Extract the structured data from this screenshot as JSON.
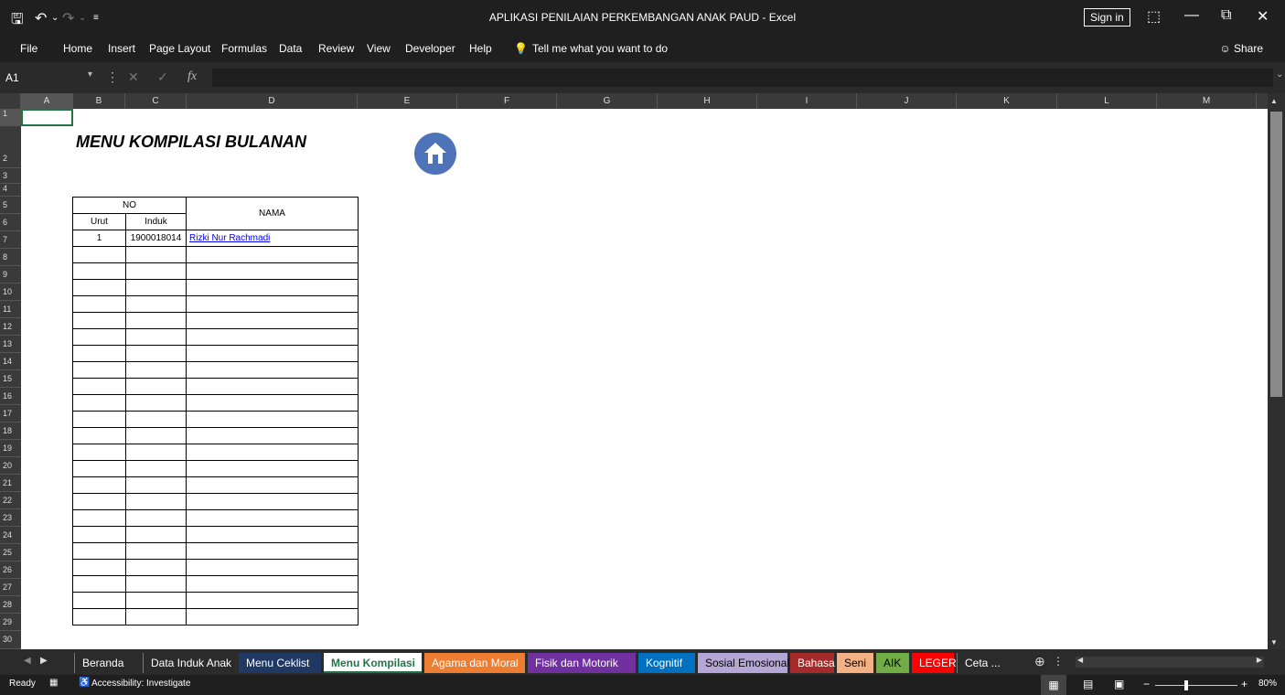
{
  "window": {
    "title": "APLIKASI PENILAIAN PERKEMBANGAN ANAK PAUD  -  Excel",
    "sign_in": "Sign in",
    "share": "Share"
  },
  "menu": [
    "File",
    "Home",
    "Insert",
    "Page Layout",
    "Formulas",
    "Data",
    "Review",
    "View",
    "Developer",
    "Help"
  ],
  "tell_me": "Tell me what you want to do",
  "formula_bar": {
    "name_box": "A1",
    "formula": ""
  },
  "columns": [
    "A",
    "B",
    "C",
    "D",
    "E",
    "F",
    "G",
    "H",
    "I",
    "J",
    "K",
    "L",
    "M"
  ],
  "rows": [
    "1",
    "2",
    "3",
    "4",
    "5",
    "6",
    "7",
    "8",
    "9",
    "10",
    "11",
    "12",
    "13",
    "14",
    "15",
    "16",
    "17",
    "18",
    "19",
    "20",
    "21",
    "22",
    "23",
    "24",
    "25",
    "26",
    "27",
    "28",
    "29",
    "30"
  ],
  "sheet": {
    "heading": "MENU KOMPILASI BULANAN",
    "table": {
      "header_no": "NO",
      "header_urut": "Urut",
      "header_induk": "Induk",
      "header_nama": "NAMA",
      "entries": [
        {
          "urut": "1",
          "induk": "1900018014",
          "nama": "Rizki Nur Rachmadi"
        }
      ]
    }
  },
  "tabs": [
    {
      "label": "Beranda",
      "bg": "#2b2b2b",
      "fg": "#ffffff"
    },
    {
      "label": "Data Induk Anak",
      "bg": "#2b2b2b",
      "fg": "#ffffff"
    },
    {
      "label": "Menu Ceklist",
      "bg": "#1f3864",
      "fg": "#ffffff"
    },
    {
      "label": "Menu Kompilasi",
      "bg": "#ffffff",
      "fg": "#217346",
      "active": true
    },
    {
      "label": "Agama dan Moral",
      "bg": "#ed7d31",
      "fg": "#ffffff"
    },
    {
      "label": "Fisik dan Motorik",
      "bg": "#7030a0",
      "fg": "#ffffff"
    },
    {
      "label": "Kognitif",
      "bg": "#0070c0",
      "fg": "#ffffff"
    },
    {
      "label": "Sosial Emosional",
      "bg": "#b4a7d6",
      "fg": "#000000"
    },
    {
      "label": "Bahasa",
      "bg": "#a52a2a",
      "fg": "#ffffff"
    },
    {
      "label": "Seni",
      "bg": "#f4b183",
      "fg": "#000000"
    },
    {
      "label": "AIK",
      "bg": "#70ad47",
      "fg": "#000000"
    },
    {
      "label": "LEGER",
      "bg": "#ff0000",
      "fg": "#ffffff"
    },
    {
      "label": "Ceta ...",
      "bg": "#2b2b2b",
      "fg": "#ffffff"
    }
  ],
  "status": {
    "ready": "Ready",
    "accessibility": "Accessibility: Investigate",
    "zoom": "80%"
  },
  "colors": {
    "accent": "#217346",
    "home_button": "#4f73b8"
  }
}
